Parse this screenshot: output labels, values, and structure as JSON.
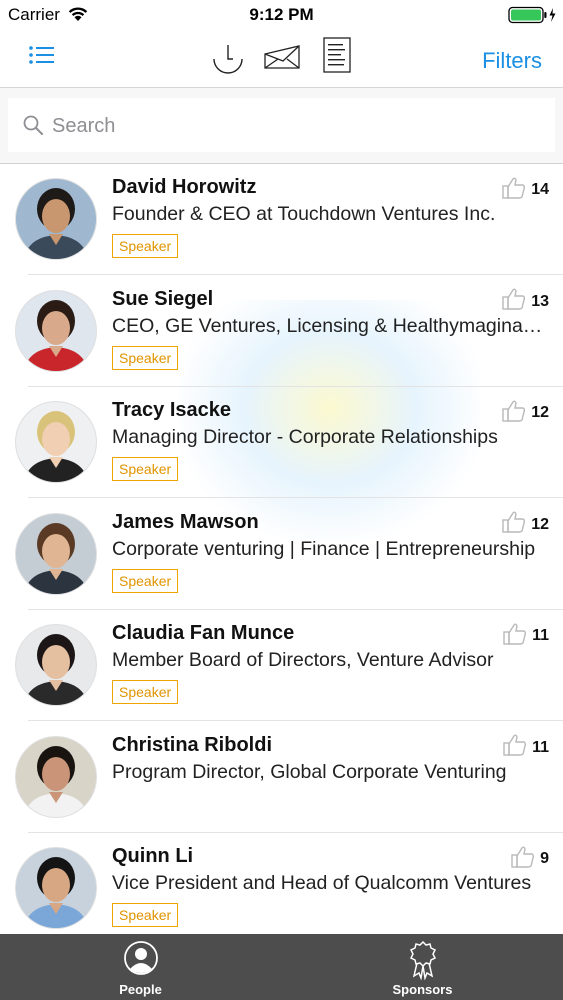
{
  "status_bar": {
    "carrier": "Carrier",
    "time": "9:12 PM"
  },
  "nav": {
    "icons": [
      "list-icon",
      "clock-icon",
      "mail-icon",
      "document-icon"
    ],
    "filters_label": "Filters",
    "accent_color": "#1a8fe3"
  },
  "search": {
    "placeholder": "Search"
  },
  "people": [
    {
      "name": "David Horowitz",
      "title": "Founder & CEO at Touchdown Ventures Inc.",
      "badge": "Speaker",
      "likes": "14"
    },
    {
      "name": "Sue Siegel",
      "title": "CEO, GE Ventures, Licensing & Healthymagination",
      "badge": "Speaker",
      "likes": "13"
    },
    {
      "name": "Tracy Isacke",
      "title": "Managing Director - Corporate Relationships",
      "badge": "Speaker",
      "likes": "12"
    },
    {
      "name": "James Mawson",
      "title": "Corporate venturing | Finance | Entrepreneurship",
      "badge": "Speaker",
      "likes": "12"
    },
    {
      "name": "Claudia Fan Munce",
      "title": "Member Board of Directors, Venture Advisor",
      "badge": "Speaker",
      "likes": "11"
    },
    {
      "name": "Christina Riboldi",
      "title": "Program Director, Global Corporate Venturing",
      "badge": "",
      "likes": "11"
    },
    {
      "name": "Quinn Li",
      "title": "Vice President and Head of Qualcomm Ventures",
      "badge": "Speaker",
      "likes": "9"
    }
  ],
  "tabs": [
    {
      "label": "People",
      "icon": "person-icon"
    },
    {
      "label": "Sponsors",
      "icon": "ribbon-award-icon"
    }
  ],
  "colors": {
    "badge": "#f0a400",
    "tab_bar": "#4d4d4d"
  }
}
